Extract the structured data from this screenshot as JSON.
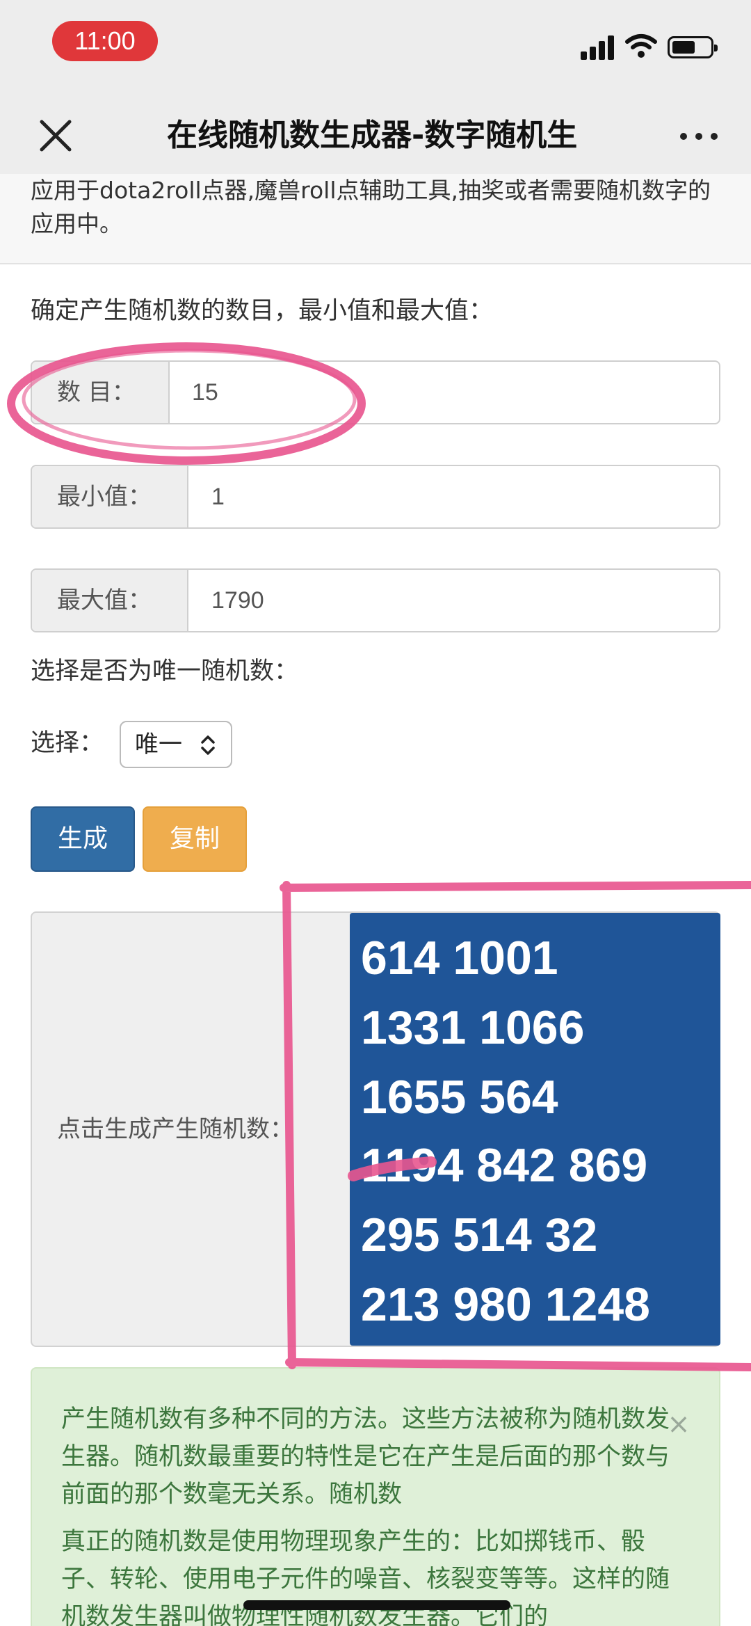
{
  "status_bar": {
    "time": "11:00",
    "icons": [
      "signal-icon",
      "wifi-icon",
      "battery-icon"
    ]
  },
  "nav": {
    "title": "在线随机数生成器-数字随机生",
    "close_icon": "close-icon",
    "more_icon": "more-icon"
  },
  "intro": {
    "text": "应用于dota2roll点器,魔兽roll点辅助工具,抽奖或者需要随机数字的应用中。"
  },
  "form": {
    "section_label": "确定产生随机数的数目，最小值和最大值：",
    "count": {
      "label": "数 目：",
      "value": "15"
    },
    "min": {
      "label": "最小值：",
      "value": "1"
    },
    "max": {
      "label": "最大值：",
      "value": "1790"
    },
    "unique_section_label": "选择是否为唯一随机数：",
    "unique": {
      "label": "选择：",
      "selected": "唯一"
    }
  },
  "actions": {
    "generate_label": "生成",
    "copy_label": "复制"
  },
  "result": {
    "label": "点击生成产生随机数：",
    "lines": [
      "614 1001",
      "1331 1066",
      "1655 564",
      "1194 842 869",
      "295 514 32",
      "213 980 1248"
    ]
  },
  "info": {
    "paragraph1": "产生随机数有多种不同的方法。这些方法被称为随机数发生器。随机数最重要的特性是它在产生是后面的那个数与前面的那个数毫无关系。随机数",
    "paragraph2": "真正的随机数是使用物理现象产生的：比如掷钱币、骰子、转轮、使用电子元件的噪音、核裂变等等。这样的随机数发生器叫做物理性随机数发生器。它们的",
    "close_symbol": "×"
  },
  "colors": {
    "primary_button": "#316da5",
    "warning_button": "#efad4e",
    "result_background": "#1f5598",
    "alert_background": "#dff0d8",
    "alert_text": "#3c763d",
    "annotation_pink": "#e8578f"
  }
}
